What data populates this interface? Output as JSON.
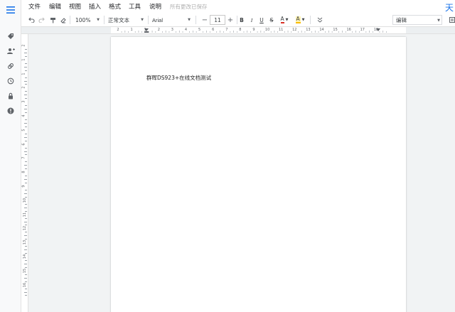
{
  "app": {
    "logo_char": "天"
  },
  "menu": {
    "items": [
      "文件",
      "编辑",
      "视图",
      "插入",
      "格式",
      "工具",
      "说明"
    ],
    "save_status": "所有更改已保存"
  },
  "toolbar": {
    "zoom": "100%",
    "style": "正常文本",
    "font": "Arial",
    "font_size": "11",
    "minus": "−",
    "plus": "+",
    "bold": "B",
    "italic": "I",
    "underline": "U",
    "strike": "S",
    "text_color": "A",
    "highlight": "A",
    "mode": "编辑",
    "text_color_value": "#d93025",
    "highlight_value": "#fbbc04"
  },
  "ruler": {
    "h_numbers": [
      "2",
      "1",
      "1",
      "2",
      "3",
      "4",
      "5",
      "6",
      "7",
      "8",
      "9",
      "10",
      "11",
      "12",
      "13",
      "14",
      "15",
      "16",
      "17",
      "18"
    ],
    "v_numbers": [
      "2",
      "1",
      "1",
      "2",
      "3",
      "4",
      "5",
      "6",
      "7",
      "8",
      "9",
      "10",
      "11",
      "12",
      "13",
      "14",
      "15",
      "16"
    ]
  },
  "document": {
    "body_text": "群晖DS923+在线文档测试"
  },
  "colors": {
    "accent": "#1a73e8",
    "page_bg": "#ffffff",
    "canvas_bg": "#f1f3f4"
  },
  "icons": {
    "sidebar": [
      "menu-icon",
      "tag-icon",
      "add-person-icon",
      "link-icon",
      "history-icon",
      "lock-icon",
      "info-icon"
    ]
  }
}
